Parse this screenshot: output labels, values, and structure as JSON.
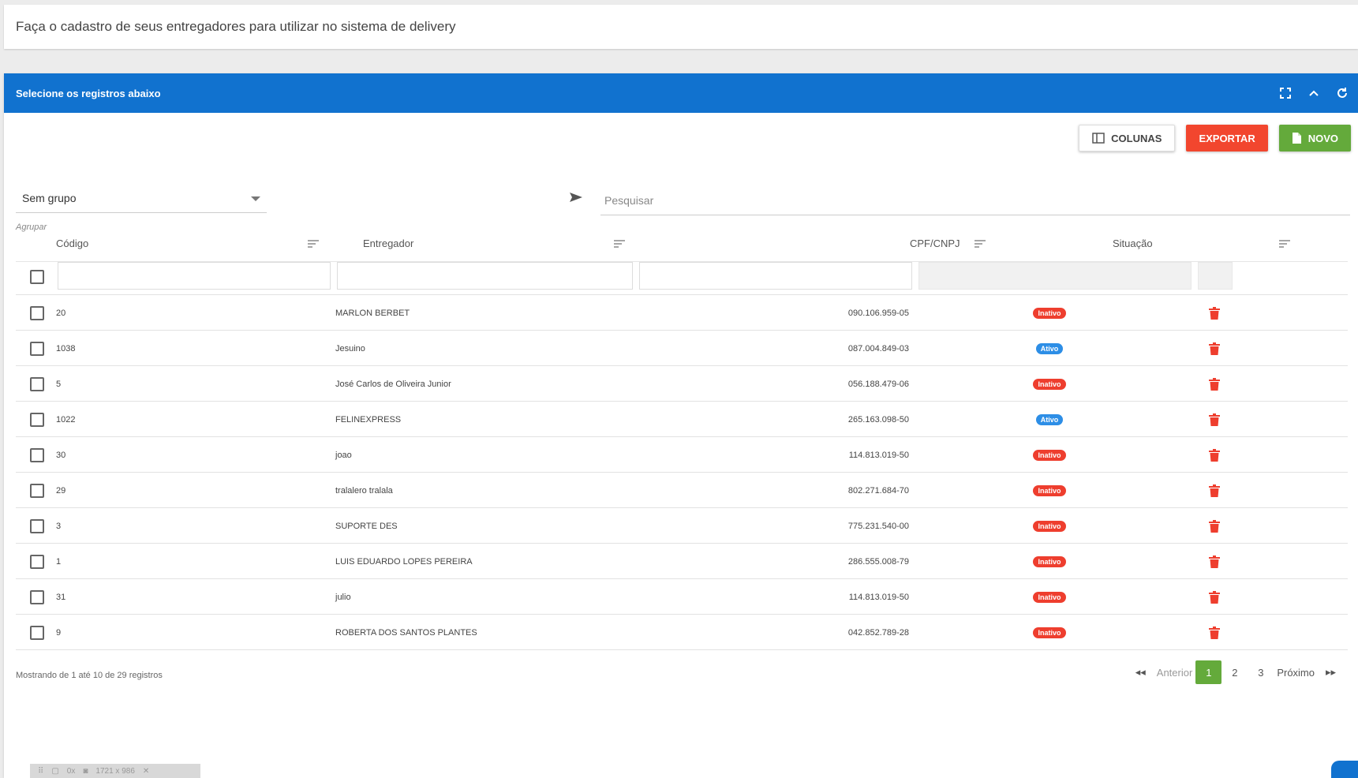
{
  "banner": {
    "text": "Faça o cadastro de seus entregadores para utilizar no sistema de delivery"
  },
  "panel": {
    "title": "Selecione os registros abaixo",
    "tools": [
      "expand-icon",
      "chevron-up-icon",
      "refresh-icon"
    ]
  },
  "toolbar": {
    "columns_label": "COLUNAS",
    "export_label": "EXPORTAR",
    "new_label": "NOVO"
  },
  "group": {
    "value": "Sem grupo",
    "hint": "Agrupar"
  },
  "search": {
    "placeholder": "Pesquisar"
  },
  "columns": {
    "codigo": "Código",
    "entregador": "Entregador",
    "cpf": "CPF/CNPJ",
    "situacao": "Situação"
  },
  "rows": [
    {
      "codigo": "20",
      "entregador": "MARLON BERBET",
      "cpf": "090.106.959-05",
      "situacao": "Inativo"
    },
    {
      "codigo": "1038",
      "entregador": "Jesuino",
      "cpf": "087.004.849-03",
      "situacao": "Ativo"
    },
    {
      "codigo": "5",
      "entregador": "José Carlos de Oliveira Junior",
      "cpf": "056.188.479-06",
      "situacao": "Inativo"
    },
    {
      "codigo": "1022",
      "entregador": "FELINEXPRESS",
      "cpf": "265.163.098-50",
      "situacao": "Ativo"
    },
    {
      "codigo": "30",
      "entregador": "joao",
      "cpf": "114.813.019-50",
      "situacao": "Inativo"
    },
    {
      "codigo": "29",
      "entregador": "tralalero tralala",
      "cpf": "802.271.684-70",
      "situacao": "Inativo"
    },
    {
      "codigo": "3",
      "entregador": "SUPORTE DES",
      "cpf": "775.231.540-00",
      "situacao": "Inativo"
    },
    {
      "codigo": "1",
      "entregador": "LUIS EDUARDO LOPES PEREIRA",
      "cpf": "286.555.008-79",
      "situacao": "Inativo"
    },
    {
      "codigo": "31",
      "entregador": "julio",
      "cpf": "114.813.019-50",
      "situacao": "Inativo"
    },
    {
      "codigo": "9",
      "entregador": "ROBERTA DOS SANTOS PLANTES",
      "cpf": "042.852.789-28",
      "situacao": "Inativo"
    }
  ],
  "footer": {
    "summary": "Mostrando de 1 até 10 de 29 registros"
  },
  "pagination": {
    "first": "◂◂",
    "prev": "Anterior",
    "pages": [
      "1",
      "2",
      "3"
    ],
    "current": "1",
    "next": "Próximo",
    "last": "▸▸"
  },
  "colors": {
    "header": "#1172cf",
    "export": "#f2462e",
    "new": "#64aa3b",
    "inactive": "#ee3e2e",
    "active": "#2d8ee6"
  },
  "devbar": {
    "zoom": "0x",
    "size": "1721 x 986"
  }
}
